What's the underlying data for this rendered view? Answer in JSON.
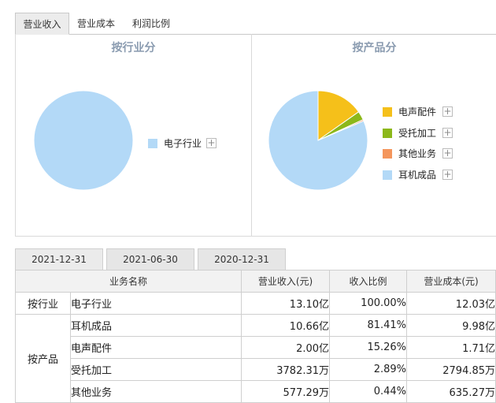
{
  "top_tabs": [
    {
      "label": "营业收入",
      "active": true
    },
    {
      "label": "营业成本",
      "active": false
    },
    {
      "label": "利润比例",
      "active": false
    }
  ],
  "industry_panel": {
    "title": "按行业分",
    "legend": [
      {
        "label": "电子行业",
        "color": "#b3d9f7"
      }
    ]
  },
  "product_panel": {
    "title": "按产品分",
    "legend": [
      {
        "label": "电声配件",
        "color": "#f5c01a"
      },
      {
        "label": "受托加工",
        "color": "#8cb81a"
      },
      {
        "label": "其他业务",
        "color": "#f4965c"
      },
      {
        "label": "耳机成品",
        "color": "#b3d9f7"
      }
    ]
  },
  "plus_symbol": "+",
  "chart_data": [
    {
      "type": "pie",
      "title": "按行业分",
      "labels": [
        "电子行业"
      ],
      "values": [
        100.0
      ],
      "colors": [
        "#b3d9f7"
      ]
    },
    {
      "type": "pie",
      "title": "按产品分",
      "labels": [
        "电声配件",
        "受托加工",
        "其他业务",
        "耳机成品"
      ],
      "values": [
        15.26,
        2.89,
        0.44,
        81.41
      ],
      "colors": [
        "#f5c01a",
        "#8cb81a",
        "#f4965c",
        "#b3d9f7"
      ]
    }
  ],
  "period_tabs": [
    {
      "label": "2021-12-31",
      "active": true
    },
    {
      "label": "2021-06-30",
      "active": false
    },
    {
      "label": "2020-12-31",
      "active": false
    }
  ],
  "table": {
    "headers": [
      "业务名称",
      "营业收入(元)",
      "收入比例",
      "营业成本(元)"
    ],
    "groups": {
      "industry": "按行业",
      "product": "按产品"
    },
    "rows": [
      {
        "name": "电子行业",
        "revenue": "13.10亿",
        "ratio": "100.00%",
        "cost": "12.03亿"
      },
      {
        "name": "耳机成品",
        "revenue": "10.66亿",
        "ratio": "81.41%",
        "cost": "9.98亿"
      },
      {
        "name": "电声配件",
        "revenue": "2.00亿",
        "ratio": "15.26%",
        "cost": "1.71亿"
      },
      {
        "name": "受托加工",
        "revenue": "3782.31万",
        "ratio": "2.89%",
        "cost": "2794.85万"
      },
      {
        "name": "其他业务",
        "revenue": "577.29万",
        "ratio": "0.44%",
        "cost": "635.27万"
      }
    ]
  }
}
